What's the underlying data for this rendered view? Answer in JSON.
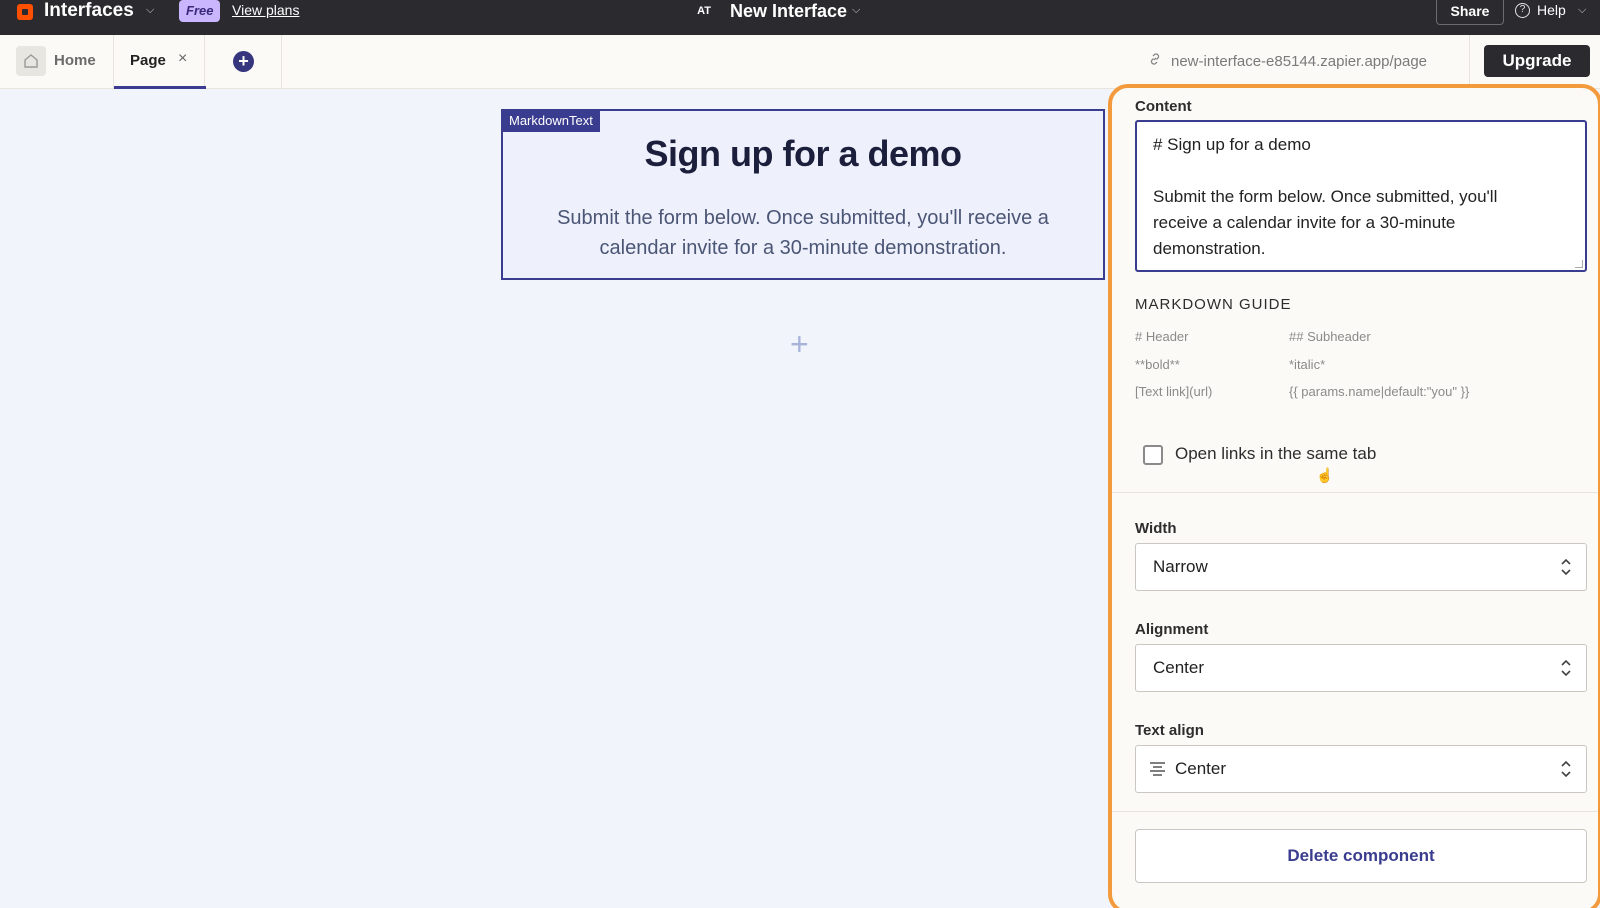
{
  "topbar": {
    "app_name": "Interfaces",
    "plan_badge": "Free",
    "view_plans": "View plans",
    "avatar_initials": "AT",
    "interface_title": "New Interface",
    "share_label": "Share",
    "help_label": "Help"
  },
  "tabs": {
    "home_label": "Home",
    "page_label": "Page",
    "close_glyph": "×",
    "add_glyph": "+",
    "url": "new-interface-e85144.zapier.app/page",
    "upgrade_label": "Upgrade"
  },
  "canvas": {
    "component_tag": "MarkdownText",
    "title": "Sign up for a demo",
    "body": "Submit the form below. Once submitted, you'll receive a calendar invite for a 30-minute demonstration.",
    "add_glyph": "+"
  },
  "panel": {
    "content_label": "Content",
    "content_lines": [
      "# Sign up for a demo",
      "",
      "Submit the form below. Once submitted, you'll",
      "receive a calendar invite for a 30-minute",
      "demonstration."
    ],
    "guide_title": "MARKDOWN GUIDE",
    "guide": {
      "header": "# Header",
      "subheader": "## Subheader",
      "bold": "**bold**",
      "italic": "*italic*",
      "link": "[Text link](url)",
      "params": "{{ params.name|default:\"you\" }}"
    },
    "same_tab_label": "Open links in the same tab",
    "same_tab_checked": false,
    "width_label": "Width",
    "width_value": "Narrow",
    "alignment_label": "Alignment",
    "alignment_value": "Center",
    "text_align_label": "Text align",
    "text_align_value": "Center",
    "delete_label": "Delete component"
  },
  "colors": {
    "accent": "#3a3d8f",
    "brand": "#ff4f00",
    "panel_highlight": "#f39a3c"
  }
}
